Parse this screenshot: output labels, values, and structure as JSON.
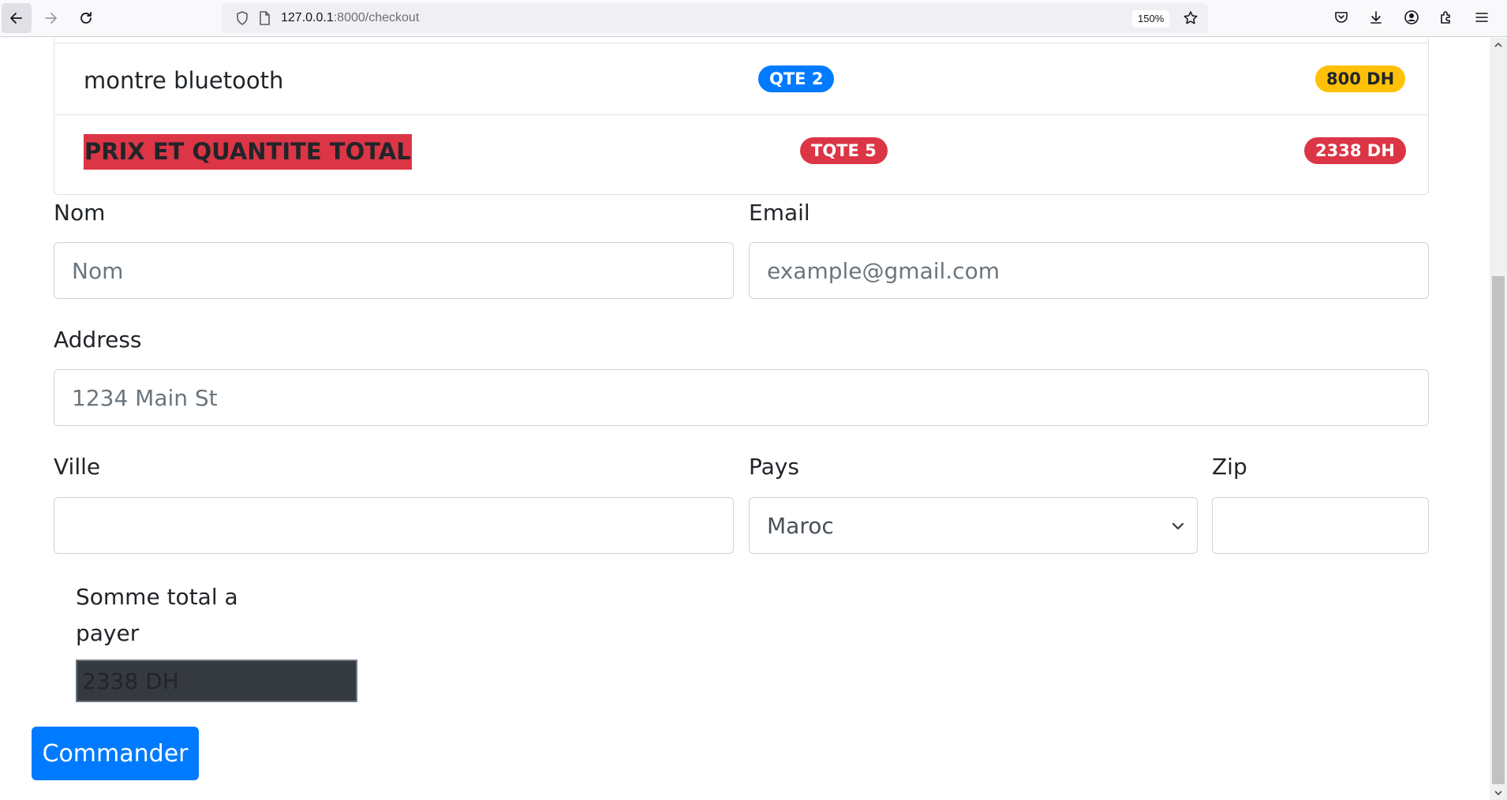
{
  "browser": {
    "url_host": "127.0.0.1",
    "url_path": ":8000/checkout",
    "zoom": "150%",
    "icons": [
      "back-icon",
      "forward-icon",
      "reload-icon",
      "shield-icon",
      "page-icon",
      "star-icon",
      "pocket-icon",
      "download-icon",
      "account-icon",
      "extensions-icon",
      "menu-icon"
    ]
  },
  "cart": {
    "item": {
      "name": "montre bluetooth",
      "qty": "QTE 2",
      "price": "800 DH"
    },
    "total": {
      "label": "PRIX ET QUANTITE TOTAL",
      "qty": "TQTE 5",
      "price": "2338 DH"
    }
  },
  "form": {
    "nom": {
      "label": "Nom",
      "placeholder": "Nom"
    },
    "email": {
      "label": "Email",
      "placeholder": "example@gmail.com"
    },
    "address": {
      "label": "Address",
      "placeholder": "1234 Main St"
    },
    "ville": {
      "label": "Ville"
    },
    "pays": {
      "label": "Pays",
      "selected": "Maroc"
    },
    "zip": {
      "label": "Zip"
    },
    "sum": {
      "label": "Somme total a payer",
      "value": "2338 DH"
    },
    "submit_label": "Commander"
  },
  "colors": {
    "primary": "#007bff",
    "warning": "#ffc107",
    "danger": "#dc3545",
    "dark": "#343a40"
  }
}
